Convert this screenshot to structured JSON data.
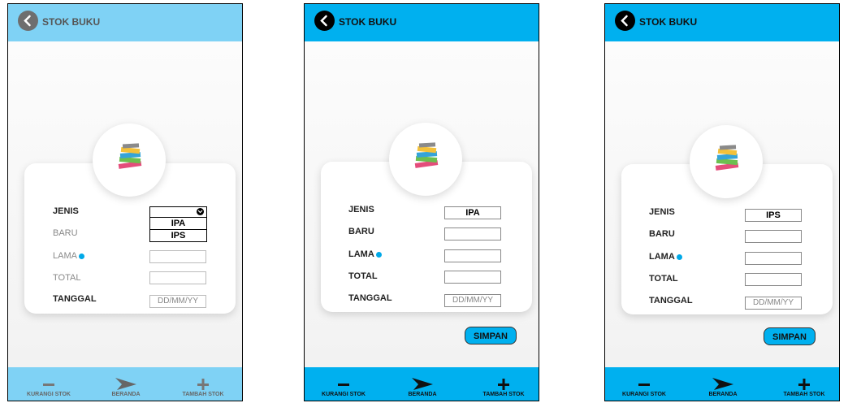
{
  "app": {
    "title": "STOK BUKU",
    "accent_color": "#00b0ef",
    "labels": {
      "jenis": "JENIS",
      "baru": "BARU",
      "lama": "LAMA",
      "total": "TOTAL",
      "tanggal": "TANGGAL"
    },
    "date_placeholder": "DD/MM/YY",
    "save_label": "SIMPAN",
    "footer": {
      "left": "KURANGI STOK",
      "center": "BERANDA",
      "right": "TAMBAH STOK"
    },
    "icons": {
      "back": "back-arrow-icon",
      "books": "books-stack-icon",
      "minus": "minus-icon",
      "home": "home-arrow-icon",
      "plus": "plus-icon",
      "info_dot": "info-dot-icon",
      "dropdown": "chevron-down-icon"
    }
  },
  "screens": [
    {
      "dropdown_options": [
        "IPA",
        "IPS"
      ]
    },
    {
      "jenis_value": "IPA"
    },
    {
      "jenis_value": "IPS"
    }
  ]
}
